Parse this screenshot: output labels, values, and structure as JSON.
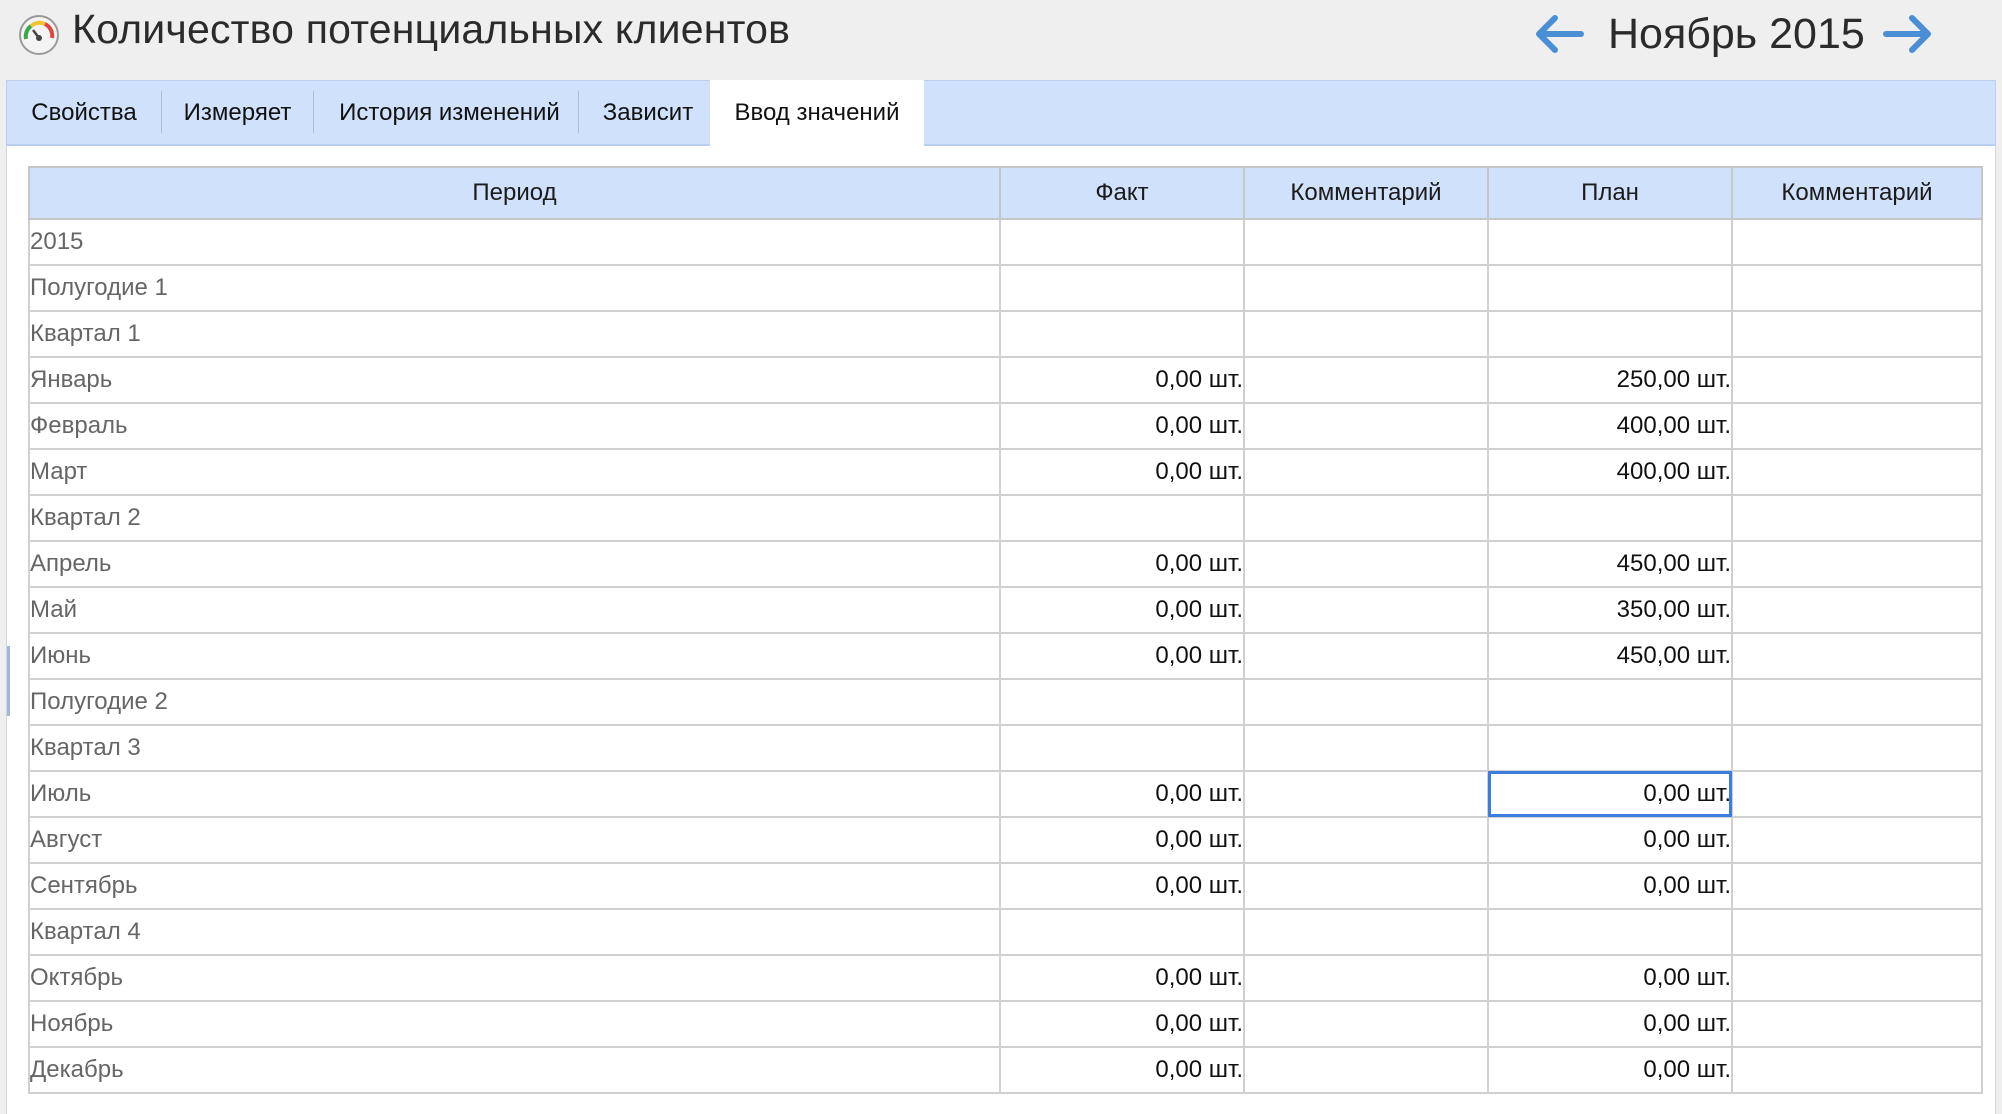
{
  "header": {
    "title": "Количество потенциальных клиентов",
    "period": "Ноябрь 2015",
    "prev_icon": "arrow-left-icon",
    "next_icon": "arrow-right-icon",
    "app_icon": "gauge-icon"
  },
  "tabs": [
    {
      "label": "Свойства",
      "active": false
    },
    {
      "label": "Измеряет",
      "active": false
    },
    {
      "label": "История изменений",
      "active": false
    },
    {
      "label": "Зависит",
      "active": false
    },
    {
      "label": "Ввод значений",
      "active": true
    }
  ],
  "table": {
    "columns": [
      "Период",
      "Факт",
      "Комментарий",
      "План",
      "Комментарий"
    ],
    "rows": [
      {
        "period": "2015",
        "level": 0,
        "fact": "",
        "fact_comment": "",
        "plan": "",
        "plan_comment": ""
      },
      {
        "period": "Полугодие 1",
        "level": 1,
        "fact": "",
        "fact_comment": "",
        "plan": "",
        "plan_comment": ""
      },
      {
        "period": "Квартал 1",
        "level": 2,
        "fact": "",
        "fact_comment": "",
        "plan": "",
        "plan_comment": ""
      },
      {
        "period": "Январь",
        "level": 3,
        "fact": "0,00 шт.",
        "fact_comment": "",
        "plan": "250,00 шт.",
        "plan_comment": ""
      },
      {
        "period": "Февраль",
        "level": 3,
        "fact": "0,00 шт.",
        "fact_comment": "",
        "plan": "400,00 шт.",
        "plan_comment": ""
      },
      {
        "period": "Март",
        "level": 3,
        "fact": "0,00 шт.",
        "fact_comment": "",
        "plan": "400,00 шт.",
        "plan_comment": ""
      },
      {
        "period": "Квартал 2",
        "level": 2,
        "fact": "",
        "fact_comment": "",
        "plan": "",
        "plan_comment": ""
      },
      {
        "period": "Апрель",
        "level": 3,
        "fact": "0,00 шт.",
        "fact_comment": "",
        "plan": "450,00 шт.",
        "plan_comment": ""
      },
      {
        "period": "Май",
        "level": 3,
        "fact": "0,00 шт.",
        "fact_comment": "",
        "plan": "350,00 шт.",
        "plan_comment": ""
      },
      {
        "period": "Июнь",
        "level": 3,
        "fact": "0,00 шт.",
        "fact_comment": "",
        "plan": "450,00 шт.",
        "plan_comment": ""
      },
      {
        "period": "Полугодие 2",
        "level": 1,
        "fact": "",
        "fact_comment": "",
        "plan": "",
        "plan_comment": ""
      },
      {
        "period": "Квартал 3",
        "level": 2,
        "fact": "",
        "fact_comment": "",
        "plan": "",
        "plan_comment": ""
      },
      {
        "period": "Июль",
        "level": 3,
        "fact": "0,00 шт.",
        "fact_comment": "",
        "plan": "0,00 шт.",
        "plan_comment": "",
        "selected": "plan"
      },
      {
        "period": "Август",
        "level": 3,
        "fact": "0,00 шт.",
        "fact_comment": "",
        "plan": "0,00 шт.",
        "plan_comment": ""
      },
      {
        "period": "Сентябрь",
        "level": 3,
        "fact": "0,00 шт.",
        "fact_comment": "",
        "plan": "0,00 шт.",
        "plan_comment": ""
      },
      {
        "period": "Квартал 4",
        "level": 2,
        "fact": "",
        "fact_comment": "",
        "plan": "",
        "plan_comment": ""
      },
      {
        "period": "Октябрь",
        "level": 3,
        "fact": "0,00 шт.",
        "fact_comment": "",
        "plan": "0,00 шт.",
        "plan_comment": ""
      },
      {
        "period": "Ноябрь",
        "level": 3,
        "fact": "0,00 шт.",
        "fact_comment": "",
        "plan": "0,00 шт.",
        "plan_comment": ""
      },
      {
        "period": "Декабрь",
        "level": 3,
        "fact": "0,00 шт.",
        "fact_comment": "",
        "plan": "0,00 шт.",
        "plan_comment": ""
      }
    ]
  },
  "colors": {
    "accent": "#3b7de0",
    "tab_bar": "#cfe1fb",
    "arrow": "#4a8fd6",
    "period_text": "#666666"
  }
}
